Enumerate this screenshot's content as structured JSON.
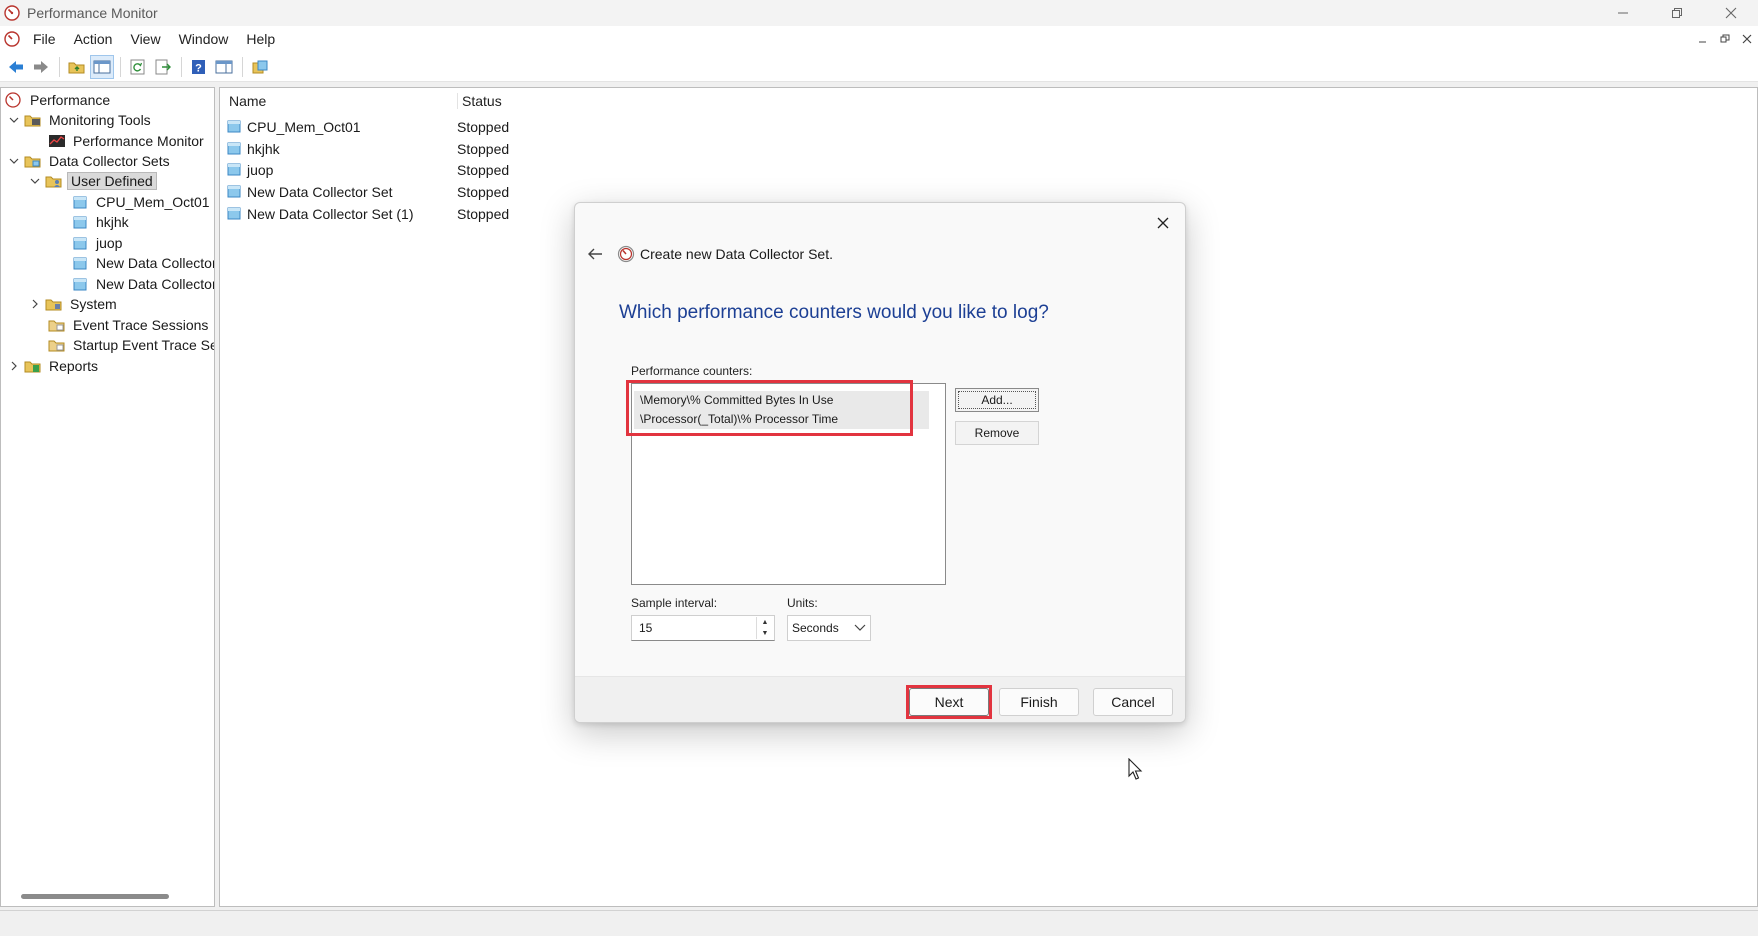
{
  "window": {
    "title": "Performance Monitor"
  },
  "menu": [
    "File",
    "Action",
    "View",
    "Window",
    "Help"
  ],
  "tree": {
    "items": [
      {
        "label": "Performance"
      },
      {
        "label": "Monitoring Tools"
      },
      {
        "label": "Performance Monitor"
      },
      {
        "label": "Data Collector Sets"
      },
      {
        "label": "User Defined"
      },
      {
        "label": "CPU_Mem_Oct01"
      },
      {
        "label": "hkjhk"
      },
      {
        "label": "juop"
      },
      {
        "label": "New Data Collector"
      },
      {
        "label": "New Data Collector"
      },
      {
        "label": "System"
      },
      {
        "label": "Event Trace Sessions"
      },
      {
        "label": "Startup Event Trace Sess"
      },
      {
        "label": "Reports"
      }
    ]
  },
  "list": {
    "columns": [
      "Name",
      "Status"
    ],
    "rows": [
      {
        "name": "CPU_Mem_Oct01",
        "status": "Stopped"
      },
      {
        "name": "hkjhk",
        "status": "Stopped"
      },
      {
        "name": "juop",
        "status": "Stopped"
      },
      {
        "name": "New Data Collector Set",
        "status": "Stopped"
      },
      {
        "name": "New Data Collector Set (1)",
        "status": "Stopped"
      }
    ]
  },
  "dialog": {
    "caption": "Create new Data Collector Set.",
    "heading": "Which performance counters would you like to log?",
    "counters_label": "Performance counters:",
    "counters": [
      "\\Memory\\% Committed Bytes In Use",
      "\\Processor(_Total)\\% Processor Time"
    ],
    "add_label": "Add...",
    "remove_label": "Remove",
    "sample_interval_label": "Sample interval:",
    "sample_interval_value": "15",
    "units_label": "Units:",
    "units_value": "Seconds",
    "next_label": "Next",
    "finish_label": "Finish",
    "cancel_label": "Cancel"
  },
  "colors": {
    "heading": "#1c3f94",
    "highlight": "#e2343f",
    "selection": "#dadada"
  }
}
